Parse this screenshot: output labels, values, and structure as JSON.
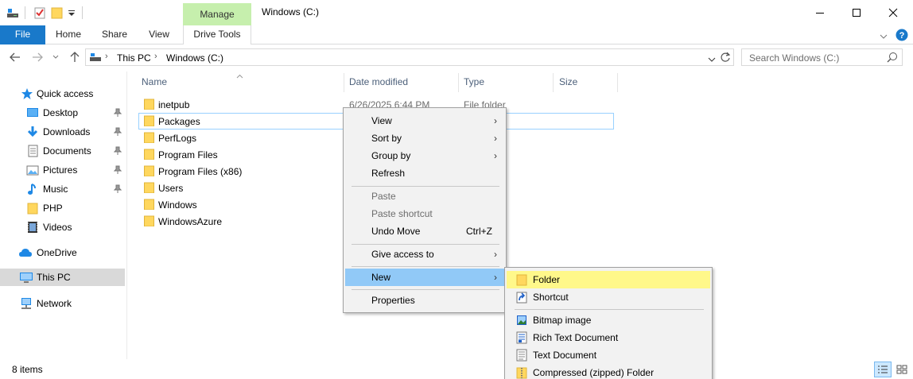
{
  "window": {
    "title": "Windows (C:)",
    "contextual_tab_group": "Manage"
  },
  "ribbon": {
    "tabs": [
      "File",
      "Home",
      "Share",
      "View",
      "Drive Tools"
    ]
  },
  "address": {
    "breadcrumbs": [
      "This PC",
      "Windows (C:)"
    ],
    "search_placeholder": "Search Windows (C:)"
  },
  "columns": {
    "name": "Name",
    "date_modified": "Date modified",
    "type": "Type",
    "size": "Size"
  },
  "nav": {
    "quick_access": "Quick access",
    "items": [
      {
        "label": "Desktop",
        "icon": "desktop-icon",
        "pinned": true
      },
      {
        "label": "Downloads",
        "icon": "downloads-icon",
        "pinned": true
      },
      {
        "label": "Documents",
        "icon": "documents-icon",
        "pinned": true
      },
      {
        "label": "Pictures",
        "icon": "pictures-icon",
        "pinned": true
      },
      {
        "label": "Music",
        "icon": "music-icon",
        "pinned": true
      },
      {
        "label": "PHP",
        "icon": "folder-icon",
        "pinned": false
      },
      {
        "label": "Videos",
        "icon": "videos-icon",
        "pinned": false
      }
    ],
    "onedrive": "OneDrive",
    "this_pc": "This PC",
    "network": "Network"
  },
  "files": [
    {
      "name": "inetpub",
      "date": "6/26/2025 6:44 PM",
      "type": "File folder"
    },
    {
      "name": "Packages",
      "date": "",
      "type": ""
    },
    {
      "name": "PerfLogs",
      "date": "",
      "type": ""
    },
    {
      "name": "Program Files",
      "date": "",
      "type": ""
    },
    {
      "name": "Program Files (x86)",
      "date": "",
      "type": ""
    },
    {
      "name": "Users",
      "date": "",
      "type": ""
    },
    {
      "name": "Windows",
      "date": "",
      "type": ""
    },
    {
      "name": "WindowsAzure",
      "date": "",
      "type": ""
    }
  ],
  "context_menu": {
    "items": {
      "view": "View",
      "sort_by": "Sort by",
      "group_by": "Group by",
      "refresh": "Refresh",
      "paste": "Paste",
      "paste_shortcut": "Paste shortcut",
      "undo_move": "Undo Move",
      "undo_move_shortcut": "Ctrl+Z",
      "give_access_to": "Give access to",
      "new": "New",
      "properties": "Properties"
    }
  },
  "new_submenu": {
    "items": {
      "folder": "Folder",
      "shortcut": "Shortcut",
      "bitmap_image": "Bitmap image",
      "rich_text_document": "Rich Text Document",
      "text_document": "Text Document",
      "compressed_folder": "Compressed (zipped) Folder"
    }
  },
  "status": {
    "item_count": "8 items"
  },
  "colors": {
    "file_tab": "#1979ca",
    "manage_tab": "#c6efad",
    "hover_blue": "#91c9f7",
    "folder_highlight": "#fff88a",
    "folder_yellow": "#ffd75e"
  }
}
